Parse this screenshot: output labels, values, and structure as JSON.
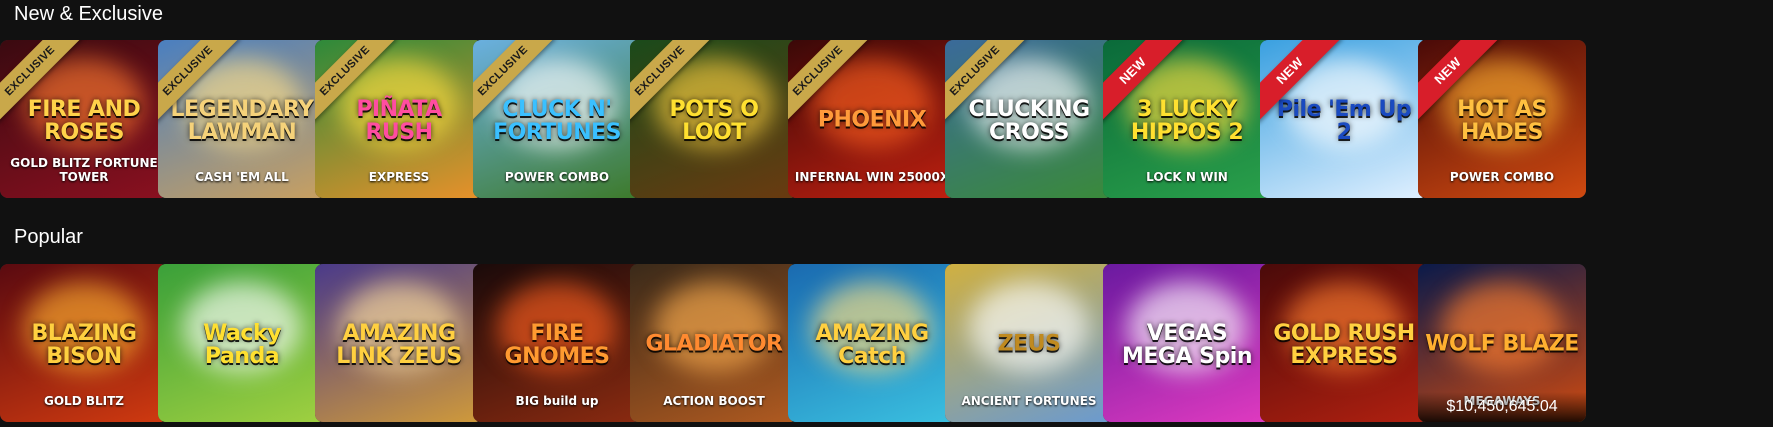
{
  "sections": {
    "new_exclusive": {
      "title": "New & Exclusive",
      "games": [
        {
          "title": "FIRE AND ROSES",
          "sub": "GOLD BLITZ FORTUNE TOWER",
          "badge": "EXCLUSIVE",
          "bg1": "#3a0a10",
          "bg2": "#8a1020",
          "glow": "#ff7a30",
          "color": "#ffd24a"
        },
        {
          "title": "LEGENDARY LAWMAN",
          "sub": "CASH 'EM ALL",
          "badge": "EXCLUSIVE",
          "bg1": "#4a7fc0",
          "bg2": "#c9a060",
          "glow": "#ffe08a",
          "color": "#f5d27a"
        },
        {
          "title": "PIÑATA RUSH",
          "sub": "EXPRESS",
          "badge": "EXCLUSIVE",
          "bg1": "#2d8a3a",
          "bg2": "#e8912a",
          "glow": "#ffe040",
          "color": "#ff4da0"
        },
        {
          "title": "CLUCK N' FORTUNES",
          "sub": "POWER COMBO",
          "badge": "EXCLUSIVE",
          "bg1": "#6ab0e0",
          "bg2": "#3d7a2a",
          "glow": "#ffffff",
          "color": "#3ac0ff"
        },
        {
          "title": "POTS O LOOT",
          "sub": "",
          "badge": "EXCLUSIVE",
          "bg1": "#1a4a1a",
          "bg2": "#6a3a10",
          "glow": "#ffd040",
          "color": "#ffe030"
        },
        {
          "title": "PHOENIX",
          "sub": "INFERNAL WIN 25000X",
          "badge": "EXCLUSIVE",
          "bg1": "#3a0808",
          "bg2": "#c02010",
          "glow": "#ff6020",
          "color": "#ff9a3a"
        },
        {
          "title": "CLUCKING CROSS",
          "sub": "",
          "badge": "EXCLUSIVE",
          "bg1": "#3a6a9a",
          "bg2": "#3a8a3a",
          "glow": "#ffffff",
          "color": "#ffffff"
        },
        {
          "title": "3 LUCKY HIPPOS 2",
          "sub": "LOCK N WIN",
          "badge": "NEW",
          "bg1": "#0a6a3a",
          "bg2": "#2aa04a",
          "glow": "#ffe040",
          "color": "#ffe030"
        },
        {
          "title": "Pile 'Em Up 2",
          "sub": "",
          "badge": "NEW",
          "bg1": "#3aa0e0",
          "bg2": "#e0f0ff",
          "glow": "#ffffff",
          "color": "#1a4ac0"
        },
        {
          "title": "HOT AS HADES",
          "sub": "POWER COMBO",
          "badge": "NEW",
          "bg1": "#4a0a08",
          "bg2": "#d04a10",
          "glow": "#ffb030",
          "color": "#ffc040"
        }
      ]
    },
    "popular": {
      "title": "Popular",
      "games": [
        {
          "title": "BLAZING BISON",
          "sub": "GOLD BLITZ",
          "bg1": "#5a0a10",
          "bg2": "#d03a10",
          "glow": "#ffb030",
          "color": "#ffd040"
        },
        {
          "title": "Wacky Panda",
          "sub": "",
          "bg1": "#3aa03a",
          "bg2": "#a0d040",
          "glow": "#ffffff",
          "color": "#ffe030"
        },
        {
          "title": "AMAZING LINK ZEUS",
          "sub": "",
          "bg1": "#4a3a8a",
          "bg2": "#d09a3a",
          "glow": "#ffe0a0",
          "color": "#ffd040"
        },
        {
          "title": "FIRE GNOMES",
          "sub": "BIG build up",
          "bg1": "#1a0a0a",
          "bg2": "#8a2a10",
          "glow": "#ff6020",
          "color": "#ff9a30"
        },
        {
          "title": "GLADIATOR",
          "sub": "ACTION BOOST",
          "bg1": "#3a2a1a",
          "bg2": "#b05a20",
          "glow": "#ffb050",
          "color": "#ff8a30"
        },
        {
          "title": "AMAZING Catch",
          "sub": "",
          "bg1": "#1a6ab0",
          "bg2": "#3ac0e0",
          "glow": "#ffe080",
          "color": "#ffd040"
        },
        {
          "title": "ZEUS",
          "sub": "ANCIENT FORTUNES",
          "bg1": "#d0b040",
          "bg2": "#6a9ad0",
          "glow": "#ffffff",
          "color": "#c08a20"
        },
        {
          "title": "VEGAS MEGA Spin",
          "sub": "",
          "bg1": "#6a1aa0",
          "bg2": "#e03ac0",
          "glow": "#ffffff",
          "color": "#ffffff"
        },
        {
          "title": "GOLD RUSH EXPRESS",
          "sub": "",
          "bg1": "#4a0a0a",
          "bg2": "#b02010",
          "glow": "#ff8030",
          "color": "#ffd040"
        },
        {
          "title": "WOLF BLAZE",
          "sub": "MEGAWAYS",
          "bg1": "#0a1a4a",
          "bg2": "#d04a10",
          "glow": "#ff8030",
          "color": "#ffb030",
          "jackpot": "$10,450,645.04"
        }
      ]
    }
  },
  "colors": {
    "page_bg": "#111111",
    "exclusive_ribbon": "#c9a84a",
    "new_ribbon": "#d81e2a"
  }
}
